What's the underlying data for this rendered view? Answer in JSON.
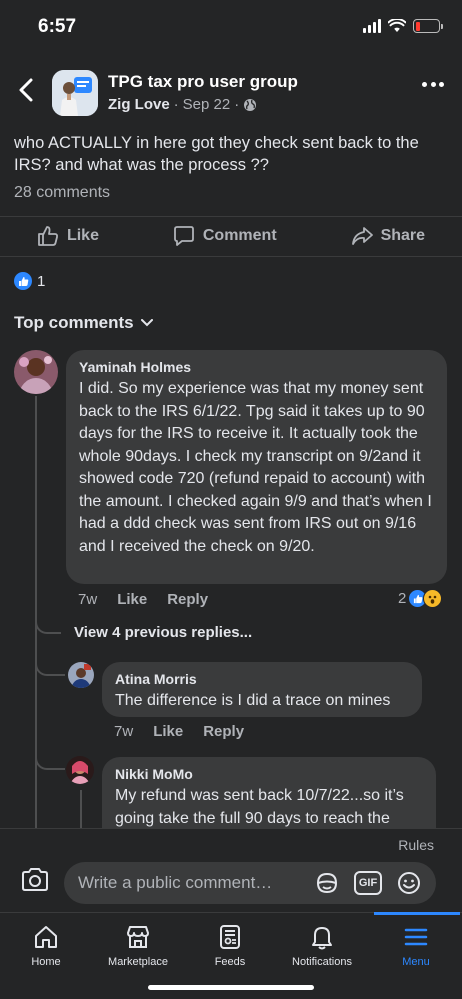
{
  "status_bar": {
    "time": "6:57",
    "icons": [
      "cellular-signal-icon",
      "wifi-icon",
      "battery-low-icon"
    ],
    "battery_level": 0.2
  },
  "post": {
    "group_name": "TPG tax pro user group",
    "author": "Zig Love",
    "date": "Sep 22",
    "separator": "·",
    "privacy_icon": "globe-icon",
    "text": "who ACTUALLY in here got they check sent back to the IRS? and what was the process ??",
    "comment_count": "28 comments",
    "reaction_count": "1"
  },
  "actions": {
    "like": "Like",
    "comment": "Comment",
    "share": "Share"
  },
  "top_comments_label": "Top comments",
  "comments": [
    {
      "name": "Yaminah Holmes",
      "text": "I did. So my experience was that my money sent back to the IRS 6/1/22. Tpg said it takes up to 90 days for the IRS to receive it. It actually took the whole 90days. I check my transcript on 9/2and it showed code 720 (refund repaid to account) with the amount. I checked again 9/9 and that’s when I had a ddd check was sent from IRS out on 9/16 and  I received the check on 9/20.",
      "time": "7w",
      "like": "Like",
      "reply": "Reply",
      "reactions": "2"
    }
  ],
  "view_replies": "View 4 previous replies...",
  "replies": [
    {
      "name": "Atina Morris",
      "text": "The difference is I did a trace on mines",
      "time": "7w",
      "like": "Like",
      "reply": "Reply"
    },
    {
      "name": "Nikki MoMo",
      "text": "My refund was sent back 10/7/22...so it’s going take the full 90 days to reach the"
    }
  ],
  "composer": {
    "rules": "Rules",
    "placeholder": "Write a public comment…",
    "gif": "GIF"
  },
  "tabs": [
    {
      "label": "Home",
      "icon": "home-icon"
    },
    {
      "label": "Marketplace",
      "icon": "marketplace-icon"
    },
    {
      "label": "Feeds",
      "icon": "feeds-icon"
    },
    {
      "label": "Notifications",
      "icon": "bell-icon"
    },
    {
      "label": "Menu",
      "icon": "menu-icon",
      "active": true
    }
  ],
  "colors": {
    "background": "#242526",
    "bubble": "#3a3b3c",
    "accent": "#2d88ff",
    "text": "#e4e6eb",
    "secondary_text": "#b0b3b8"
  }
}
